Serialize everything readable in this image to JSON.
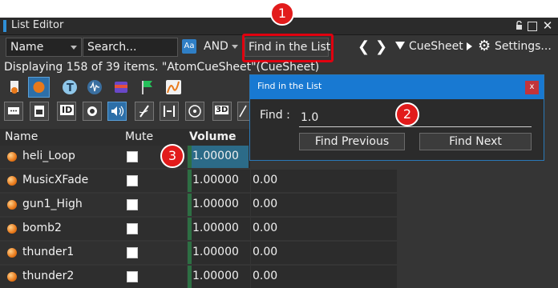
{
  "window": {
    "title": "List Editor"
  },
  "toolbar": {
    "name_select": "Name",
    "search_placeholder": "Search...",
    "match_case_label": "Aa",
    "and_select": "AND",
    "find_button": "Find in the List",
    "cuesheet_label": "CueSheet",
    "settings_label": "Settings..."
  },
  "status": {
    "text": "Displaying 158 of 39 items. \"AtomCueSheet\"(CueSheet)"
  },
  "columns": {
    "name": "Name",
    "mute": "Mute",
    "volume": "Volume"
  },
  "rows": [
    {
      "name": "heli_Loop",
      "volume": "1.00000",
      "extra": ""
    },
    {
      "name": "MusicXFade",
      "volume": "1.00000",
      "extra": "0.00"
    },
    {
      "name": "gun1_High",
      "volume": "1.00000",
      "extra": "0.00"
    },
    {
      "name": "bomb2",
      "volume": "1.00000",
      "extra": "0.00"
    },
    {
      "name": "thunder1",
      "volume": "1.00000",
      "extra": "0.00"
    },
    {
      "name": "thunder2",
      "volume": "1.00000",
      "extra": "0.00"
    }
  ],
  "icon_row2": {
    "id_label": "ID",
    "threed_label": "3D"
  },
  "dialog": {
    "title": "Find in the List",
    "close_label": "x",
    "find_label": "Find :",
    "find_value": "1.0",
    "find_previous": "Find Previous",
    "find_next": "Find Next"
  },
  "callouts": {
    "one": "1",
    "two": "2",
    "three": "3"
  },
  "colors": {
    "accent": "#1879d2",
    "callout": "#e21b1b",
    "cue_orange": "#e8791a",
    "volume_bar": "#2d6f43"
  }
}
